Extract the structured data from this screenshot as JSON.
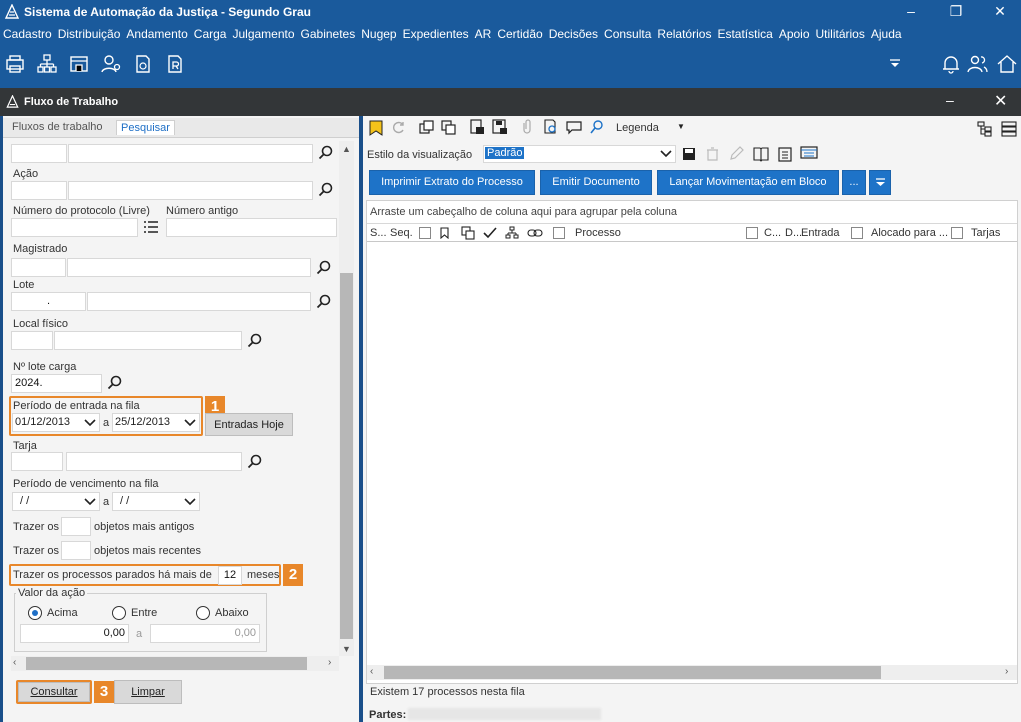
{
  "window": {
    "title": "Sistema de Automação da Justiça - Segundo Grau",
    "buttons": [
      "minimize",
      "restore",
      "close"
    ]
  },
  "menu": [
    "Cadastro",
    "Distribuição",
    "Andamento",
    "Carga",
    "Julgamento",
    "Gabinetes",
    "Nugep",
    "Expedientes",
    "AR",
    "Certidão",
    "Decisões",
    "Consulta",
    "Relatórios",
    "Estatística",
    "Apoio",
    "Utilitários",
    "Ajuda"
  ],
  "toolbar_icons": [
    "printer-icon",
    "org-chart-icon",
    "building-icon",
    "user-key-icon",
    "document-clock-icon",
    "document-r-icon"
  ],
  "toolbar_right_icons": [
    "dropdown-arrow-icon",
    "bell-icon",
    "users-icon",
    "home-icon"
  ],
  "flux": {
    "title": "Fluxo de Trabalho",
    "tabs": {
      "fluxos": "Fluxos de trabalho",
      "pesquisar": "Pesquisar"
    },
    "fields": {
      "acao": "Ação",
      "protocolo": "Número do protocolo (Livre)",
      "numero_antigo": "Número antigo",
      "magistrado": "Magistrado",
      "lote": "Lote",
      "lote_value": ".",
      "local_fisico": "Local físico",
      "lote_carga": "Nº lote carga",
      "lote_carga_value": "2024.",
      "periodo_entrada": "Período de entrada na fila",
      "date_from": "01/12/2013",
      "date_sep": "a",
      "date_to": "25/12/2013",
      "entradas_hoje": "Entradas Hoje",
      "tarja": "Tarja",
      "periodo_venc": "Período de vencimento na fila",
      "venc_from": "/ /",
      "venc_sep": "a",
      "venc_to": "/ /",
      "trazer_os_1": "Trazer os",
      "antigos": "objetos mais antigos",
      "trazer_os_2": "Trazer os",
      "recentes": "objetos mais recentes",
      "parados": "Trazer os processos parados há mais de",
      "parados_value": "12",
      "meses": "meses",
      "valor_acao": "Valor da ação",
      "radio_acima": "Acima",
      "radio_entre": "Entre",
      "radio_abaixo": "Abaixo",
      "valor_from": "0,00",
      "valor_sep": "a",
      "valor_to": "0,00"
    },
    "badges": [
      "1",
      "2",
      "3"
    ],
    "buttons": {
      "consultar": "Consultar",
      "limpar": "Limpar"
    }
  },
  "right": {
    "legenda": "Legenda",
    "estilo_label": "Estilo da visualização",
    "estilo_value": "Padrão",
    "actions": [
      "Imprimir Extrato do Processo",
      "Emitir Documento",
      "Lançar Movimentação em Bloco",
      "..."
    ],
    "group_hint": "Arraste um cabeçalho de coluna aqui para agrupar pela coluna",
    "columns": {
      "s": "S...",
      "seq": "Seq.",
      "processo": "Processo",
      "c": "C...",
      "d": "D...",
      "entrada": "Entrada",
      "alocado": "Alocado para ...",
      "tarjas": "Tarjas"
    },
    "status": "Existem 17 processos nesta fila",
    "partes": "Partes:"
  },
  "colors": {
    "accent": "#1e73c8",
    "titlebar": "#1a5a9c",
    "highlight": "#e8872a",
    "panelhead": "#333638"
  }
}
